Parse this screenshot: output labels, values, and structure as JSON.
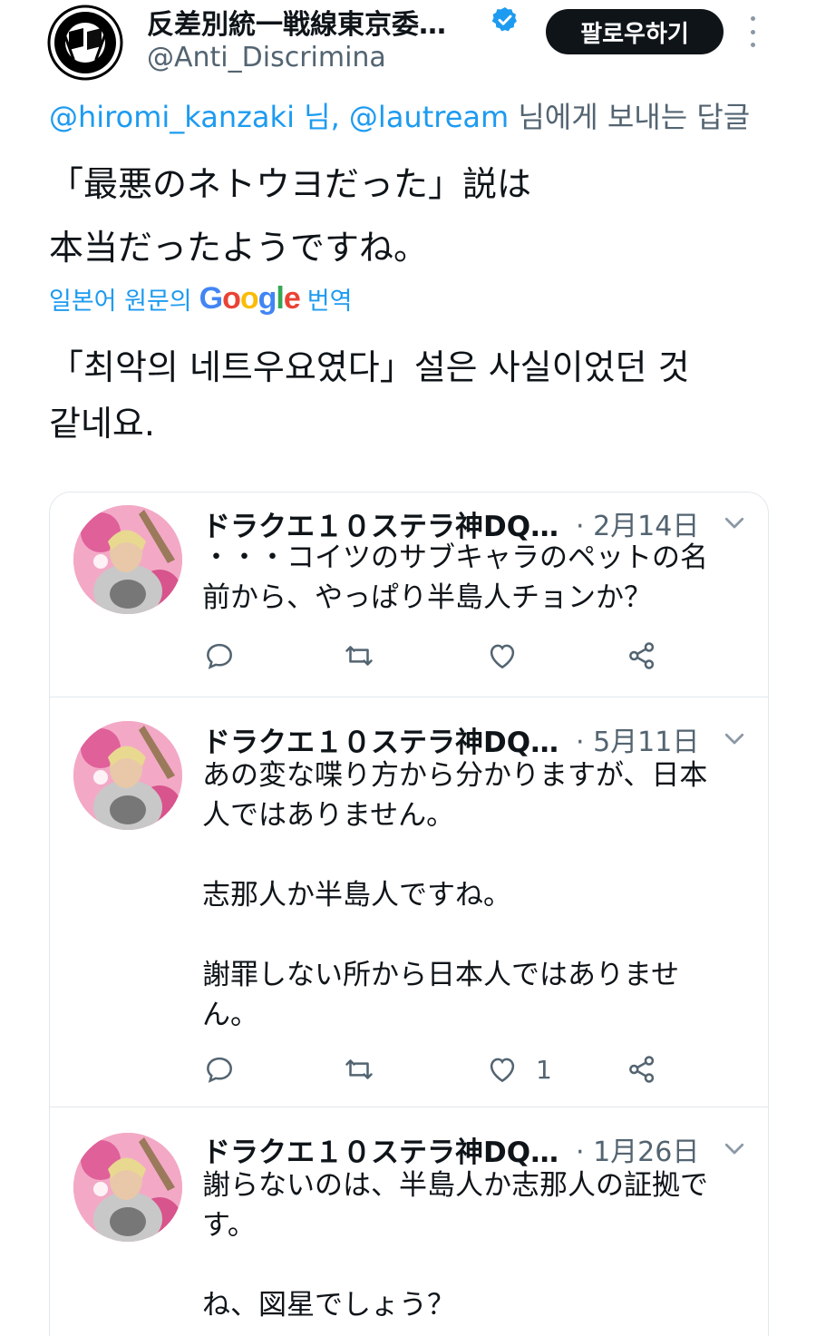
{
  "header": {
    "display_name": "反差別統一戦線東京委…",
    "handle": "@Anti_Discrimina",
    "follow_label": "팔로우하기"
  },
  "reply": {
    "mention1": "@hiromi_kanzaki",
    "sep1": " 님, ",
    "mention2": "@lautream",
    "suffix": " 님에게 보내는 답글"
  },
  "tweet": {
    "lines": [
      "「最悪のネトウヨだった」説は",
      "本当だったようですね。"
    ]
  },
  "translation": {
    "prefix": "일본어 원문의",
    "google": "Google",
    "suffix": "번역",
    "lines": [
      "「최악의 네트우요였다」설은 사실이었던 것",
      "같네요."
    ]
  },
  "quoted_tweets": [
    {
      "name": "ドラクエ１０ステラ神DQ…",
      "date": "· 2月14日",
      "lines": [
        "・・・コイツのサブキャラのペットの名",
        "前から、やっぱり半島人チョンか？"
      ],
      "like_count": ""
    },
    {
      "name": "ドラクエ１０ステラ神DQ…",
      "date": "· 5月11日",
      "lines": [
        "あの変な喋り方から分かりますが、日本",
        "人ではありません。",
        "",
        "志那人か半島人ですね。",
        "",
        "謝罪しない所から日本人ではありませ",
        "ん。"
      ],
      "like_count": "1"
    },
    {
      "name": "ドラクエ１０ステラ神DQ…",
      "date": "· 1月26日",
      "lines": [
        "謝らないのは、半島人か志那人の証拠で",
        "す。",
        "",
        "ね、図星でしょう？"
      ],
      "like_count": ""
    }
  ],
  "colors": {
    "link": "#1d9bf0",
    "secondary_text": "#536471",
    "primary_text": "#0f1419",
    "border": "#e1e8ed",
    "follow_button": "#0f1419"
  },
  "icons": [
    "antifa-flag-avatar",
    "verified-badge-icon",
    "more-vertical-icon",
    "chevron-down-icon",
    "reply-icon",
    "retweet-icon",
    "like-icon",
    "share-icon"
  ]
}
